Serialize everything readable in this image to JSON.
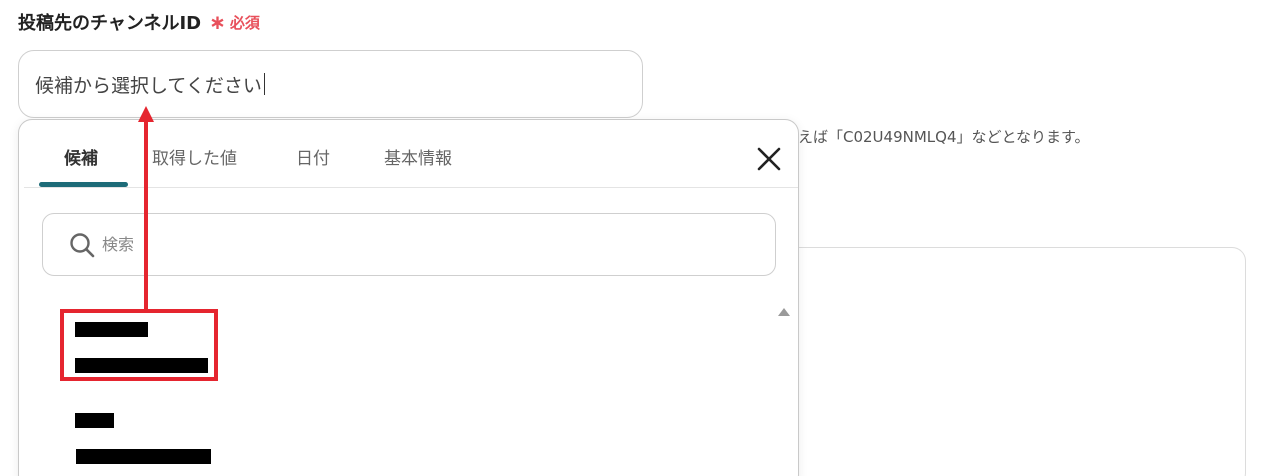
{
  "field": {
    "label": "投稿先のチャンネルID",
    "required_mark": "∗",
    "required_text": "必須",
    "input_value": "候補から選択してください",
    "hint": "えば「C02U49NMLQ4」などとなります。"
  },
  "popover": {
    "tabs": [
      {
        "label": "候補",
        "active": true
      },
      {
        "label": "取得した値",
        "active": false
      },
      {
        "label": "日付",
        "active": false
      },
      {
        "label": "基本情報",
        "active": false
      }
    ],
    "close_icon": "close-icon",
    "search": {
      "placeholder": "検索",
      "icon": "search-icon"
    },
    "list_items": [
      {
        "name": "[redacted]",
        "id": "[redacted]"
      },
      {
        "name": "[redacted]",
        "id": "[redacted]"
      }
    ]
  },
  "annotation": {
    "color": "#e5252f"
  },
  "colors": {
    "required": "#e8505b",
    "tab_indicator": "#1d6b78"
  }
}
